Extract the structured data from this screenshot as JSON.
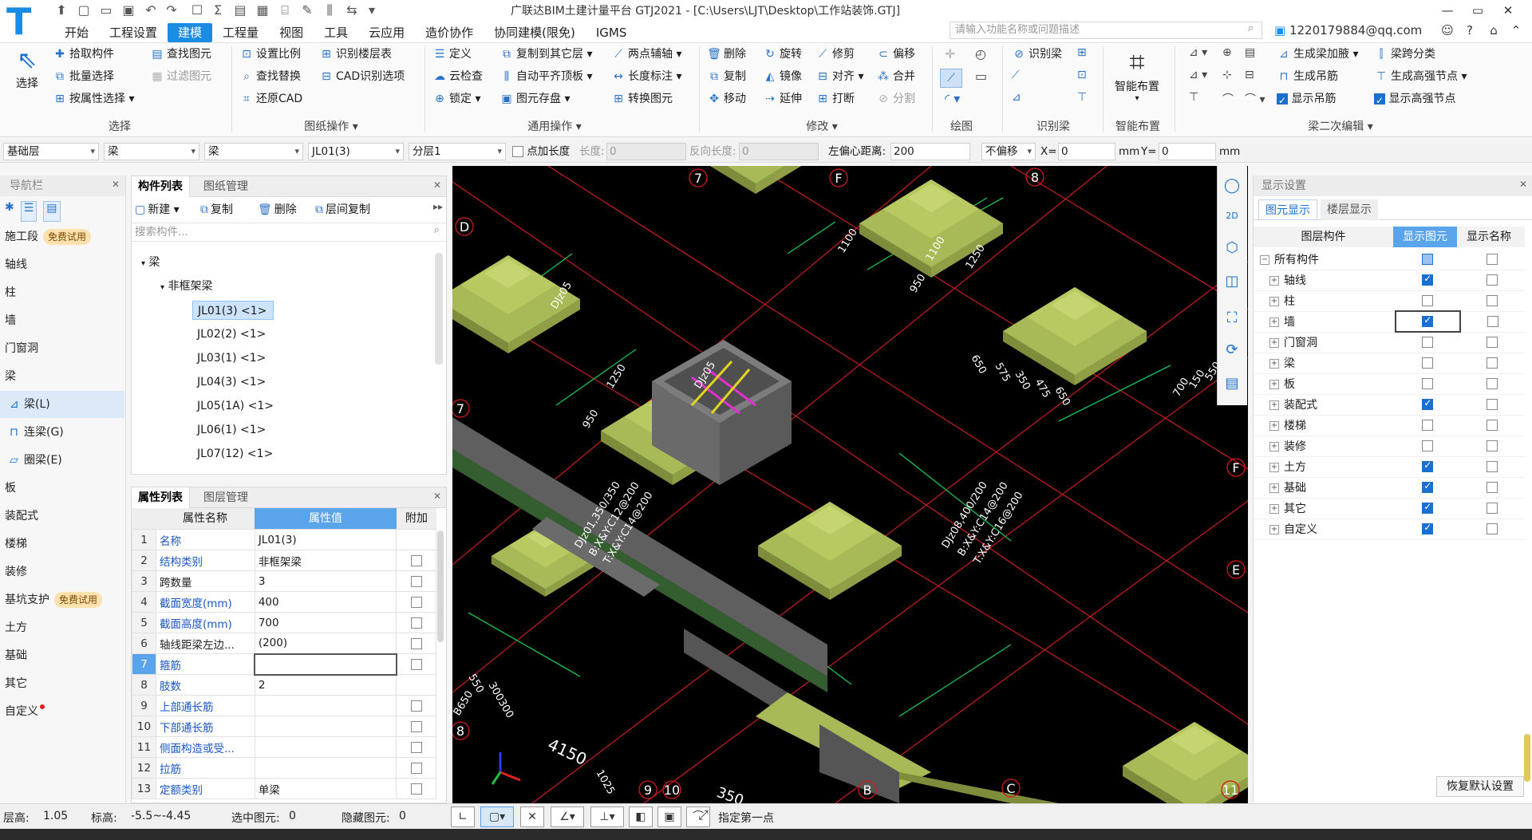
{
  "app": {
    "title": "广联达BIM土建计量平台 GTJ2021 - [C:\\Users\\LJT\\Desktop\\工作站装饰.GTJ]",
    "logo": "T"
  },
  "menu": [
    "开始",
    "工程设置",
    "建模",
    "工程量",
    "视图",
    "工具",
    "云应用",
    "造价协作",
    "协同建模(限免)",
    "IGMS"
  ],
  "menu_active": "建模",
  "search": {
    "placeholder": "请输入功能名称或问题描述"
  },
  "user": {
    "account": "1220179884@qq.com"
  },
  "ribbon": {
    "select": {
      "label": "选择",
      "big": "选择",
      "items": [
        "拾取构件",
        "批量选择",
        "按属性选择",
        "查找图元",
        "过滤图元"
      ]
    },
    "drawing_ops": {
      "label": "图纸操作",
      "items": [
        "设置比例",
        "识别楼层表",
        "查找替换",
        "CAD识别选项",
        "还原CAD"
      ]
    },
    "common_ops": {
      "label": "通用操作",
      "items": [
        "定义",
        "复制到其它层",
        "两点辅轴",
        "云检查",
        "自动平齐顶板",
        "长度标注",
        "锁定",
        "图元存盘",
        "转换图元"
      ]
    },
    "modify": {
      "label": "修改",
      "items": [
        "删除",
        "旋转",
        "修剪",
        "偏移",
        "复制",
        "镜像",
        "对齐",
        "合并",
        "移动",
        "延伸",
        "打断",
        "分割"
      ]
    },
    "draw": {
      "label": "绘图"
    },
    "identify_beam": {
      "label": "识别梁",
      "big": "识别梁"
    },
    "smart_layout": {
      "label": "智能布置",
      "big": "智能布置"
    },
    "beam_edit": {
      "label": "梁二次编辑",
      "items": [
        "生成梁加腋",
        "梁跨分类",
        "生成吊筋",
        "生成高强节点",
        "显示吊筋",
        "显示高强节点"
      ]
    }
  },
  "propbar": {
    "floor": "基础层",
    "type1": "梁",
    "type2": "梁",
    "comp": "JL01(3)",
    "layer": "分层1",
    "point_len": "点加长度",
    "len_label": "长度:",
    "len_val": "0",
    "rev_label": "反向长度:",
    "rev_val": "0",
    "offset_label": "左偏心距离:",
    "offset_val": "200",
    "nooffset": "不偏移",
    "x_label": "X=",
    "x_val": "0",
    "unit1": "mm",
    "y_label": "Y=",
    "y_val": "0",
    "unit2": "mm"
  },
  "nav": {
    "title": "导航栏",
    "trial": "免费试用",
    "items": [
      {
        "label": "施工段",
        "badge": true
      },
      {
        "label": "轴线"
      },
      {
        "label": "柱"
      },
      {
        "label": "墙"
      },
      {
        "label": "门窗洞"
      },
      {
        "label": "梁"
      },
      {
        "label": "梁(L)",
        "sub": true,
        "sel": true
      },
      {
        "label": "连梁(G)",
        "sub": true
      },
      {
        "label": "圈梁(E)",
        "sub": true
      },
      {
        "label": "板"
      },
      {
        "label": "装配式"
      },
      {
        "label": "楼梯"
      },
      {
        "label": "装修"
      },
      {
        "label": "基坑支护",
        "badge": true
      },
      {
        "label": "土方"
      },
      {
        "label": "基础"
      },
      {
        "label": "其它"
      },
      {
        "label": "自定义"
      }
    ]
  },
  "components": {
    "tabs": [
      "构件列表",
      "图纸管理"
    ],
    "buttons": [
      "新建",
      "复制",
      "删除",
      "层间复制"
    ],
    "search_placeholder": "搜索构件...",
    "root": "梁",
    "group": "非框架梁",
    "items": [
      "JL01(3) <1>",
      "JL02(2) <1>",
      "JL03(1) <1>",
      "JL04(3) <1>",
      "JL05(1A) <1>",
      "JL06(1) <1>",
      "JL07(12) <1>"
    ]
  },
  "properties": {
    "tabs": [
      "属性列表",
      "图层管理"
    ],
    "headers": [
      "属性名称",
      "属性值",
      "附加"
    ],
    "rows": [
      {
        "n": "1",
        "k": "名称",
        "v": "JL01(3)",
        "blue": true,
        "cb": false
      },
      {
        "n": "2",
        "k": "结构类别",
        "v": "非框架梁",
        "blue": true,
        "cb": true
      },
      {
        "n": "3",
        "k": "跨数量",
        "v": "3",
        "blue": false,
        "cb": true
      },
      {
        "n": "4",
        "k": "截面宽度(mm)",
        "v": "400",
        "blue": true,
        "cb": true
      },
      {
        "n": "5",
        "k": "截面高度(mm)",
        "v": "700",
        "blue": true,
        "cb": true
      },
      {
        "n": "6",
        "k": "轴线距梁左边...",
        "v": "(200)",
        "blue": false,
        "cb": true
      },
      {
        "n": "7",
        "k": "箍筋",
        "v": "",
        "blue": true,
        "cb": true
      },
      {
        "n": "8",
        "k": "肢数",
        "v": "2",
        "blue": true,
        "cb": false
      },
      {
        "n": "9",
        "k": "上部通长筋",
        "v": "",
        "blue": true,
        "cb": true
      },
      {
        "n": "10",
        "k": "下部通长筋",
        "v": "",
        "blue": true,
        "cb": true
      },
      {
        "n": "11",
        "k": "侧面构造或受...",
        "v": "",
        "blue": true,
        "cb": true
      },
      {
        "n": "12",
        "k": "拉筋",
        "v": "",
        "blue": true,
        "cb": true
      },
      {
        "n": "13",
        "k": "定额类别",
        "v": "单梁",
        "blue": true,
        "cb": true
      }
    ]
  },
  "display": {
    "title": "显示设置",
    "tabs": [
      "图元显示",
      "楼层显示"
    ],
    "headers": [
      "图层构件",
      "显示图元",
      "显示名称"
    ],
    "rows": [
      {
        "label": "所有构件",
        "show": "partial",
        "name": false
      },
      {
        "label": "轴线",
        "show": true,
        "name": false
      },
      {
        "label": "柱",
        "show": false,
        "name": false
      },
      {
        "label": "墙",
        "show": true,
        "name": false
      },
      {
        "label": "门窗洞",
        "show": false,
        "name": false
      },
      {
        "label": "梁",
        "show": false,
        "name": false
      },
      {
        "label": "板",
        "show": false,
        "name": false
      },
      {
        "label": "装配式",
        "show": true,
        "name": false
      },
      {
        "label": "楼梯",
        "show": false,
        "name": false
      },
      {
        "label": "装修",
        "show": false,
        "name": false
      },
      {
        "label": "土方",
        "show": true,
        "name": false
      },
      {
        "label": "基础",
        "show": true,
        "name": false
      },
      {
        "label": "其它",
        "show": true,
        "name": false
      },
      {
        "label": "自定义",
        "show": true,
        "name": false
      }
    ],
    "restore": "恢复默认设置"
  },
  "viewport": {
    "axes": [
      "D",
      "F",
      "E",
      "C",
      "B",
      "8",
      "7",
      "9",
      "10",
      "11",
      "F",
      "E",
      "D",
      "B"
    ],
    "labels": [
      "DJz05",
      "DJz05",
      "DJz08,400/200",
      "B:X&Y:C14@200",
      "T:X&Y:C16@200",
      "DJz01,350/350",
      "B:X&Y:C12@200",
      "T:X&Y:C14@200",
      "B650",
      "4150",
      "1100",
      "1100",
      "950",
      "1250",
      "950",
      "1250",
      "650",
      "575",
      "350",
      "475",
      "650",
      "700",
      "150",
      "550",
      "1025",
      "350",
      "550",
      "300300"
    ],
    "colors": {
      "footing": "#a8b957",
      "footing_dark": "#6f7d34",
      "base": "#17c95a",
      "pit": "#6a6a6a",
      "axis": "#d11a1a",
      "dim": "#18c456"
    }
  },
  "status": {
    "floor_h": "层高:",
    "floor_h_val": "1.05",
    "elev": "标高:",
    "elev_val": "-5.5~-4.45",
    "selected": "选中图元:",
    "selected_val": "0",
    "hidden": "隐藏图元:",
    "hidden_val": "0",
    "prompt": "指定第一点"
  }
}
